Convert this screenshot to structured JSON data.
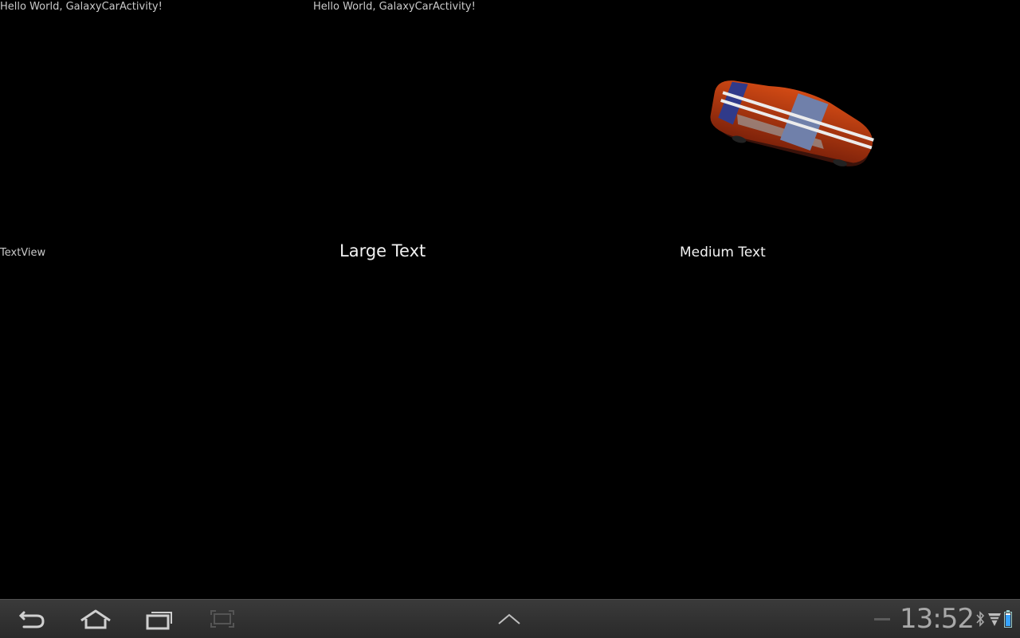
{
  "content": {
    "hello_left": "Hello World, GalaxyCarActivity!",
    "hello_center": "Hello World, GalaxyCarActivity!",
    "textview": "TextView",
    "large_text": "Large Text",
    "medium_text": "Medium Text"
  },
  "car_image": {
    "icon": "red-sports-car-3d-model",
    "body_color": "#b83a10",
    "stripe_color": "#e8e8e8",
    "roof_color": "#6f7fa8"
  },
  "system_bar": {
    "buttons": [
      "back-icon",
      "home-icon",
      "recent-apps-icon",
      "screenshot-icon",
      "menu-up-icon"
    ],
    "clock": "13:52",
    "status_icons": [
      "bluetooth-icon",
      "wifi-icon",
      "battery-icon"
    ]
  }
}
